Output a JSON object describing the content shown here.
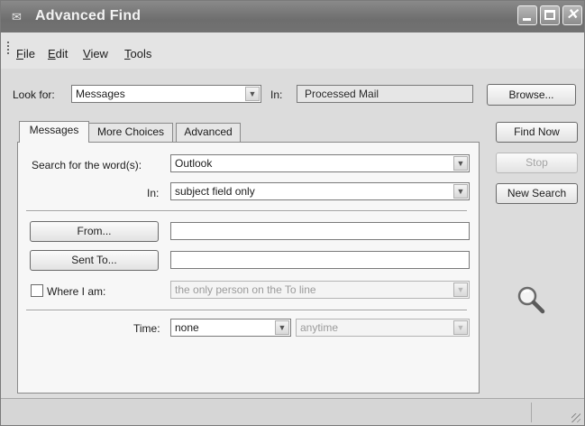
{
  "window": {
    "title": "Advanced Find"
  },
  "menu": [
    {
      "label": "File",
      "mnemonic": "F",
      "rest": "ile"
    },
    {
      "label": "Edit",
      "mnemonic": "E",
      "rest": "dit"
    },
    {
      "label": "View",
      "mnemonic": "V",
      "rest": "iew"
    },
    {
      "label": "Tools",
      "mnemonic": "T",
      "rest": "ools"
    }
  ],
  "look_for": {
    "label": "Look for:",
    "value": "Messages",
    "in_label": "In:",
    "in_value": "Processed Mail",
    "browse_label": "Browse..."
  },
  "tabs": [
    "Messages",
    "More Choices",
    "Advanced"
  ],
  "messages_tab": {
    "search_label": "Search for the word(s):",
    "search_value": "Outlook",
    "in_label": "In:",
    "in_value": "subject field only",
    "from_label": "From...",
    "from_value": "",
    "sent_to_label": "Sent To...",
    "sent_to_value": "",
    "where_label": "Where I am:",
    "where_checked": false,
    "where_value": "the only person on the To line",
    "time_label": "Time:",
    "time_value": "none",
    "time_range_value": "anytime"
  },
  "actions": {
    "find_now": "Find Now",
    "stop": "Stop",
    "new_search": "New Search"
  },
  "icons": {
    "title": "envelope-arrow-icon",
    "search_graphic": "magnifier-icon"
  }
}
